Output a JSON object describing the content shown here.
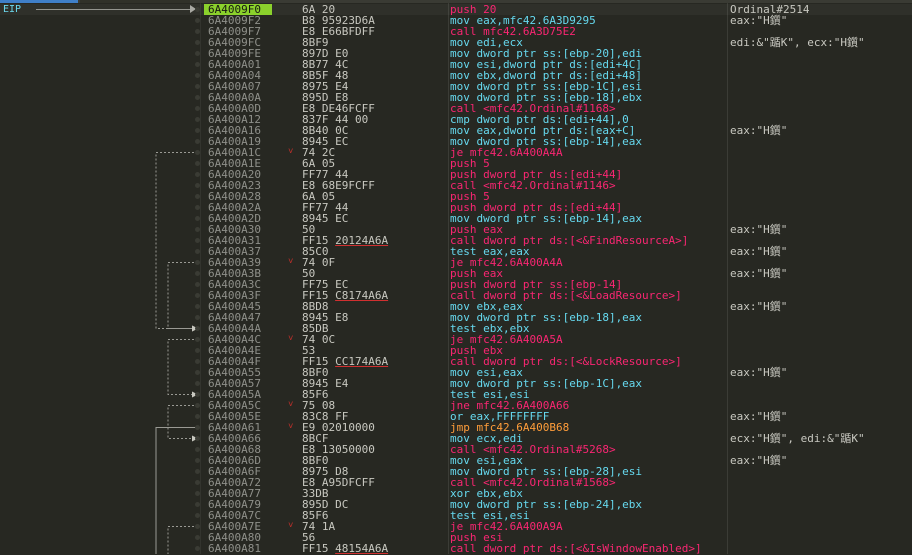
{
  "eip_label": "EIP",
  "rows": [
    {
      "addr": "6A4009F0",
      "bytes": "6A 20",
      "instr": "push 20",
      "type": "push",
      "comment": "Ordinal#2514",
      "current": true
    },
    {
      "addr": "6A4009F2",
      "bytes": "B8 95923D6A",
      "instr": "mov eax,mfc42.6A3D9295",
      "type": "mov",
      "comment": "eax:\"H鑕\""
    },
    {
      "addr": "6A4009F7",
      "bytes": "E8 E66BFDFF",
      "instr": "call mfc42.6A3D75E2",
      "type": "call",
      "comment": ""
    },
    {
      "addr": "6A4009FC",
      "bytes": "8BF9",
      "instr": "mov edi,ecx",
      "type": "mov",
      "comment": "edi:&\"踲K\", ecx:\"H鑕\""
    },
    {
      "addr": "6A4009FE",
      "bytes": "897D E0",
      "instr": "mov dword ptr ss:[ebp-20],edi",
      "type": "mov",
      "comment": ""
    },
    {
      "addr": "6A400A01",
      "bytes": "8B77 4C",
      "instr": "mov esi,dword ptr ds:[edi+4C]",
      "type": "mov",
      "comment": ""
    },
    {
      "addr": "6A400A04",
      "bytes": "8B5F 48",
      "instr": "mov ebx,dword ptr ds:[edi+48]",
      "type": "mov",
      "comment": ""
    },
    {
      "addr": "6A400A07",
      "bytes": "8975 E4",
      "instr": "mov dword ptr ss:[ebp-1C],esi",
      "type": "mov",
      "comment": ""
    },
    {
      "addr": "6A400A0A",
      "bytes": "895D E8",
      "instr": "mov dword ptr ss:[ebp-18],ebx",
      "type": "mov",
      "comment": ""
    },
    {
      "addr": "6A400A0D",
      "bytes": "E8 DE46FCFF",
      "instr": "call <mfc42.Ordinal#1168>",
      "type": "call",
      "comment": ""
    },
    {
      "addr": "6A400A12",
      "bytes": "837F 44 00",
      "instr": "cmp dword ptr ds:[edi+44],0",
      "type": "cmp",
      "comment": ""
    },
    {
      "addr": "6A400A16",
      "bytes": "8B40 0C",
      "instr": "mov eax,dword ptr ds:[eax+C]",
      "type": "mov",
      "comment": "eax:\"H鑕\""
    },
    {
      "addr": "6A400A19",
      "bytes": "8945 EC",
      "instr": "mov dword ptr ss:[ebp-14],eax",
      "type": "mov",
      "comment": ""
    },
    {
      "addr": "6A400A1C",
      "bytes": "74 2C",
      "instr": "je mfc42.6A400A4A",
      "type": "jcc",
      "comment": "",
      "jmark": true
    },
    {
      "addr": "6A400A1E",
      "bytes": "6A 05",
      "instr": "push 5",
      "type": "push",
      "comment": ""
    },
    {
      "addr": "6A400A20",
      "bytes": "FF77 44",
      "instr": "push dword ptr ds:[edi+44]",
      "type": "push",
      "comment": ""
    },
    {
      "addr": "6A400A23",
      "bytes": "E8 68E9FCFF",
      "instr": "call <mfc42.Ordinal#1146>",
      "type": "call",
      "comment": ""
    },
    {
      "addr": "6A400A28",
      "bytes": "6A 05",
      "instr": "push 5",
      "type": "push",
      "comment": ""
    },
    {
      "addr": "6A400A2A",
      "bytes": "FF77 44",
      "instr": "push dword ptr ds:[edi+44]",
      "type": "push",
      "comment": ""
    },
    {
      "addr": "6A400A2D",
      "bytes": "8945 EC",
      "instr": "mov dword ptr ss:[ebp-14],eax",
      "type": "mov",
      "comment": ""
    },
    {
      "addr": "6A400A30",
      "bytes": "50",
      "instr": "push eax",
      "type": "push",
      "comment": "eax:\"H鑕\""
    },
    {
      "addr": "6A400A31",
      "bytes": "FF15 20124A6A",
      "instr": "call dword ptr ds:[<&FindResourceA>]",
      "type": "call",
      "comment": "",
      "ul": "20124A6A"
    },
    {
      "addr": "6A400A37",
      "bytes": "85C0",
      "instr": "test eax,eax",
      "type": "mov",
      "comment": "eax:\"H鑕\""
    },
    {
      "addr": "6A400A39",
      "bytes": "74 0F",
      "instr": "je mfc42.6A400A4A",
      "type": "jcc",
      "comment": "",
      "jmark": true
    },
    {
      "addr": "6A400A3B",
      "bytes": "50",
      "instr": "push eax",
      "type": "push",
      "comment": "eax:\"H鑕\""
    },
    {
      "addr": "6A400A3C",
      "bytes": "FF75 EC",
      "instr": "push dword ptr ss:[ebp-14]",
      "type": "push",
      "comment": ""
    },
    {
      "addr": "6A400A3F",
      "bytes": "FF15 C8174A6A",
      "instr": "call dword ptr ds:[<&LoadResource>]",
      "type": "call",
      "comment": "",
      "ul": "C8174A6A"
    },
    {
      "addr": "6A400A45",
      "bytes": "8BD8",
      "instr": "mov ebx,eax",
      "type": "mov",
      "comment": "eax:\"H鑕\""
    },
    {
      "addr": "6A400A47",
      "bytes": "8945 E8",
      "instr": "mov dword ptr ss:[ebp-18],eax",
      "type": "mov",
      "comment": ""
    },
    {
      "addr": "6A400A4A",
      "bytes": "85DB",
      "instr": "test ebx,ebx",
      "type": "mov",
      "comment": ""
    },
    {
      "addr": "6A400A4C",
      "bytes": "74 0C",
      "instr": "je mfc42.6A400A5A",
      "type": "jcc",
      "comment": "",
      "jmark": true
    },
    {
      "addr": "6A400A4E",
      "bytes": "53",
      "instr": "push ebx",
      "type": "push",
      "comment": ""
    },
    {
      "addr": "6A400A4F",
      "bytes": "FF15 CC174A6A",
      "instr": "call dword ptr ds:[<&LockResource>]",
      "type": "call",
      "comment": "",
      "ul": "CC174A6A"
    },
    {
      "addr": "6A400A55",
      "bytes": "8BF0",
      "instr": "mov esi,eax",
      "type": "mov",
      "comment": "eax:\"H鑕\""
    },
    {
      "addr": "6A400A57",
      "bytes": "8945 E4",
      "instr": "mov dword ptr ss:[ebp-1C],eax",
      "type": "mov",
      "comment": ""
    },
    {
      "addr": "6A400A5A",
      "bytes": "85F6",
      "instr": "test esi,esi",
      "type": "mov",
      "comment": ""
    },
    {
      "addr": "6A400A5C",
      "bytes": "75 08",
      "instr": "jne mfc42.6A400A66",
      "type": "jcc",
      "comment": "",
      "jmark": true
    },
    {
      "addr": "6A400A5E",
      "bytes": "83C8 FF",
      "instr": "or eax,FFFFFFFF",
      "type": "or",
      "comment": "eax:\"H鑕\""
    },
    {
      "addr": "6A400A61",
      "bytes": "E9 02010000",
      "instr": "jmp mfc42.6A400B68",
      "type": "jmp",
      "comment": "",
      "jmark": true
    },
    {
      "addr": "6A400A66",
      "bytes": "8BCF",
      "instr": "mov ecx,edi",
      "type": "mov",
      "comment": "ecx:\"H鑕\", edi:&\"踲K\""
    },
    {
      "addr": "6A400A68",
      "bytes": "E8 13050000",
      "instr": "call <mfc42.Ordinal#5268>",
      "type": "call",
      "comment": ""
    },
    {
      "addr": "6A400A6D",
      "bytes": "8BF0",
      "instr": "mov esi,eax",
      "type": "mov",
      "comment": "eax:\"H鑕\""
    },
    {
      "addr": "6A400A6F",
      "bytes": "8975 D8",
      "instr": "mov dword ptr ss:[ebp-28],esi",
      "type": "mov",
      "comment": ""
    },
    {
      "addr": "6A400A72",
      "bytes": "E8 A95DFCFF",
      "instr": "call <mfc42.Ordinal#1568>",
      "type": "call",
      "comment": ""
    },
    {
      "addr": "6A400A77",
      "bytes": "33DB",
      "instr": "xor ebx,ebx",
      "type": "xor",
      "comment": ""
    },
    {
      "addr": "6A400A79",
      "bytes": "895D DC",
      "instr": "mov dword ptr ss:[ebp-24],ebx",
      "type": "mov",
      "comment": ""
    },
    {
      "addr": "6A400A7C",
      "bytes": "85F6",
      "instr": "test esi,esi",
      "type": "mov",
      "comment": ""
    },
    {
      "addr": "6A400A7E",
      "bytes": "74 1A",
      "instr": "je mfc42.6A400A9A",
      "type": "jcc",
      "comment": "",
      "jmark": true
    },
    {
      "addr": "6A400A80",
      "bytes": "56",
      "instr": "push esi",
      "type": "push",
      "comment": ""
    },
    {
      "addr": "6A400A81",
      "bytes": "FF15 48154A6A",
      "instr": "call dword ptr ds:[<&IsWindowEnabled>]",
      "type": "call",
      "comment": "",
      "ul": "48154A6A"
    }
  ],
  "jumps": [
    {
      "from": 13,
      "to": 29,
      "lane": 0,
      "dashed": true
    },
    {
      "from": 23,
      "to": 29,
      "lane": 1,
      "dashed": true
    },
    {
      "from": 30,
      "to": 35,
      "lane": 1,
      "dashed": true
    },
    {
      "from": 36,
      "to": 39,
      "lane": 1,
      "dashed": true
    },
    {
      "from": 38,
      "to": 50,
      "lane": 0,
      "dashed": false
    },
    {
      "from": 47,
      "to": 50,
      "lane": 1,
      "dashed": true
    }
  ],
  "colors": {
    "background": "#272822",
    "current_addr": "#8bd12c",
    "call_push": "#f92672",
    "jmp": "#ff9d3a",
    "mov": "#66d9ef"
  }
}
